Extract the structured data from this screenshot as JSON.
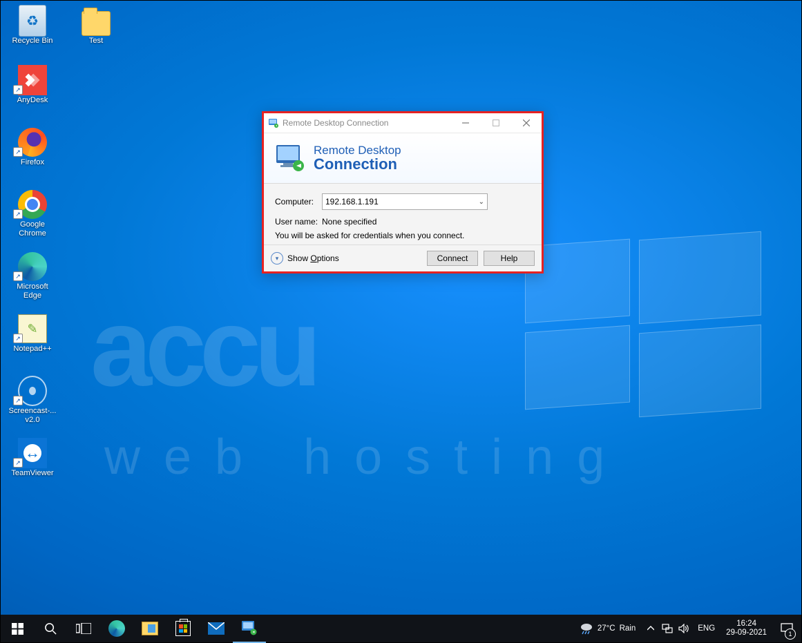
{
  "desktop": {
    "icons_top": [
      {
        "label": "Recycle Bin"
      },
      {
        "label": "Test"
      }
    ],
    "icons_left": [
      {
        "label": "AnyDesk"
      },
      {
        "label": "Firefox"
      },
      {
        "label": "Google Chrome"
      },
      {
        "label": "Microsoft Edge"
      },
      {
        "label": "Notepad++"
      },
      {
        "label": "Screencast-... v2.0"
      },
      {
        "label": "TeamViewer"
      }
    ],
    "watermark_main": "accu",
    "watermark_sub": "web hosting"
  },
  "dialog": {
    "window_title": "Remote Desktop Connection",
    "banner_line1": "Remote Desktop",
    "banner_line2": "Connection",
    "computer_label": "Computer:",
    "computer_value": "192.168.1.191",
    "username_label": "User name:",
    "username_value": "None specified",
    "hint_text": "You will be asked for credentials when you connect.",
    "show_options": "Show Options",
    "connect": "Connect",
    "help": "Help"
  },
  "taskbar": {
    "weather_temp": "27°C",
    "weather_text": "Rain",
    "lang": "ENG",
    "time": "16:24",
    "date": "29-09-2021",
    "notif_count": "1"
  }
}
